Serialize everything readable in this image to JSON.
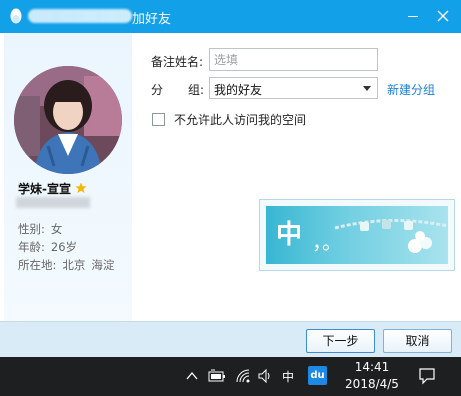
{
  "dialog": {
    "title": "加好友",
    "buttons": {
      "next": "下一步",
      "cancel": "取消"
    }
  },
  "profile": {
    "nickname": "学妹-宣宣",
    "info": {
      "gender_label": "性别:",
      "gender": "女",
      "age_label": "年龄:",
      "age": "26岁",
      "location_label": "所在地:",
      "city": "北京",
      "district": "海淀"
    }
  },
  "form": {
    "remark_label": "备注姓名:",
    "remark_placeholder": "选填",
    "group_label_1": "分",
    "group_label_2": "组:",
    "group_value": "我的好友",
    "new_group_link": "新建分组",
    "no_space_access_label": "不允许此人访问我的空间",
    "no_space_access_checked": false
  },
  "ime_panel": {
    "mode_char": "中",
    "punct": "，。"
  },
  "taskbar": {
    "ime_mode": "中",
    "ime_badge": "du",
    "time": "14:41",
    "date": "2018/4/5"
  },
  "colors": {
    "titlebar": "#12a0e8",
    "link": "#1a7fd8",
    "footer": "#d8ebf7",
    "taskbar": "#1e1f21"
  },
  "icons": [
    "qq-penguin-icon",
    "minimize-icon",
    "close-icon",
    "star-icon",
    "chevron-up-icon",
    "battery-icon",
    "wifi-icon",
    "speaker-icon",
    "notification-icon"
  ]
}
